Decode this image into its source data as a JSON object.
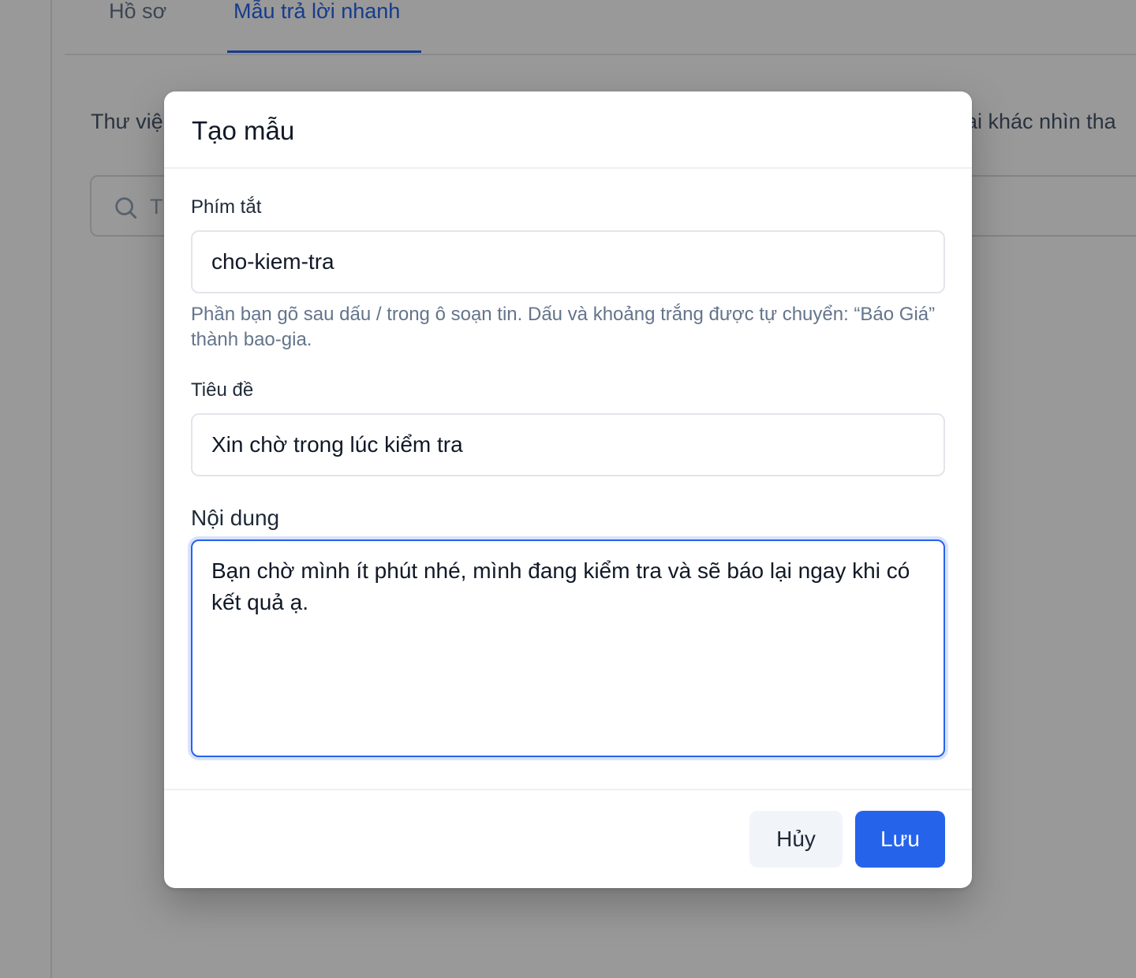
{
  "tabs": {
    "profile": "Hồ sơ",
    "quick_replies": "Mẫu trả lời nhanh"
  },
  "background": {
    "description_left": "Thư việ",
    "description_right": "ai khác nhìn tha",
    "search_placeholder": "T"
  },
  "modal": {
    "title": "Tạo mẫu",
    "shortcut": {
      "label": "Phím tắt",
      "value": "cho-kiem-tra",
      "hint": "Phần bạn gõ sau dấu / trong ô soạn tin. Dấu và khoảng trắng được tự chuyển: “Báo Giá” thành bao-gia."
    },
    "title_field": {
      "label": "Tiêu đề",
      "value": "Xin chờ trong lúc kiểm tra"
    },
    "content": {
      "label": "Nội dung",
      "value": "Bạn chờ mình ít phút nhé, mình đang kiểm tra và sẽ báo lại ngay khi có kết quả ạ."
    },
    "buttons": {
      "cancel": "Hủy",
      "save": "Lưu"
    }
  },
  "colors": {
    "accent": "#2563eb",
    "overlay": "rgba(0,0,0,0.4)",
    "hint_text": "#64748b"
  },
  "icons": {
    "search": "search-icon"
  }
}
